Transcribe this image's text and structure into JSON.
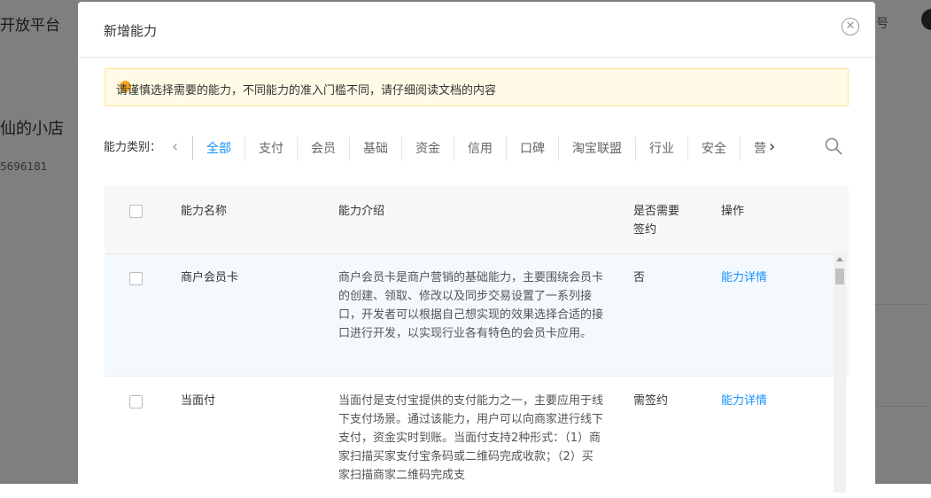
{
  "background": {
    "platform_title": "开放平台",
    "shop_name": "仙的小店",
    "shop_id": "5696181",
    "right_text": "号"
  },
  "modal": {
    "title": "新增能力",
    "close_icon": "close-circle-icon",
    "notice": "请谨慎选择需要的能力，不同能力的准入门槛不同，请仔细阅读文档的内容",
    "category_label": "能力类别：",
    "categories": [
      "全部",
      "支付",
      "会员",
      "基础",
      "资金",
      "信用",
      "口碑",
      "淘宝联盟",
      "行业",
      "安全",
      "营"
    ],
    "active_category": "全部",
    "columns": {
      "name": "能力名称",
      "desc": "能力介绍",
      "sign_line1": "是否需要",
      "sign_line2": "签约",
      "action": "操作"
    },
    "rows": [
      {
        "name": "商户会员卡",
        "desc": "商户会员卡是商户营销的基础能力，主要围绕会员卡的创建、领取、修改以及同步交易设置了一系列接口，开发者可以根据自己想实现的效果选择合适的接口进行开发，以实现行业各有特色的会员卡应用。",
        "sign": "否",
        "action": "能力详情"
      },
      {
        "name": "当面付",
        "desc": "当面付是支付宝提供的支付能力之一，主要应用于线下支付场景。通过该能力，用户可以向商家进行线下支付，资金实时到账。当面付支持2种形式：（1）商家扫描买家支付宝条码或二维码完成收款；（2）买家扫描商家二维码完成支",
        "sign": "需签约",
        "action": "能力详情"
      }
    ]
  },
  "colors": {
    "accent": "#1890ff",
    "notice_bg": "#fffbe6",
    "notice_border": "#ffe58f"
  }
}
